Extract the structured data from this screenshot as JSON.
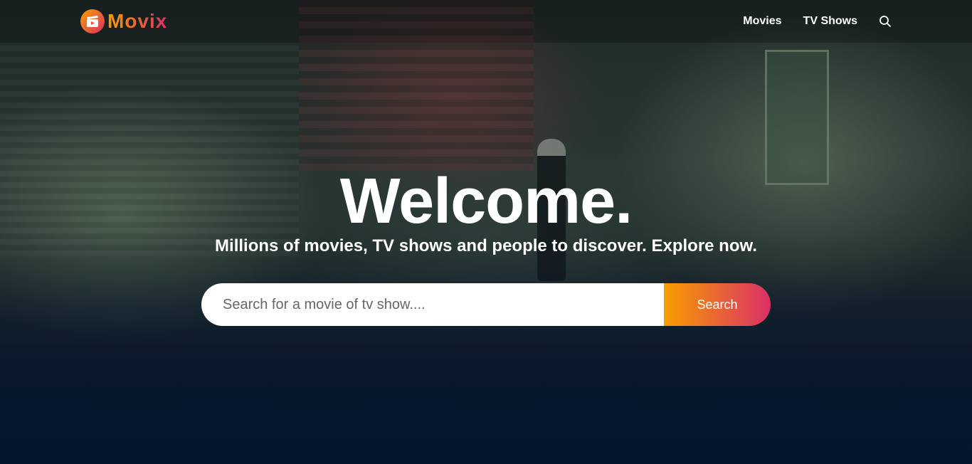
{
  "header": {
    "logo_text": "Movix",
    "nav": {
      "movies_label": "Movies",
      "tv_shows_label": "TV Shows",
      "search_icon": "search-icon"
    }
  },
  "hero": {
    "title": "Welcome.",
    "subtitle": "Millions of movies, TV shows and people to discover. Explore now.",
    "search": {
      "placeholder": "Search for a movie of tv show....",
      "value": "",
      "button_label": "Search"
    }
  },
  "colors": {
    "background": "#04152d",
    "accent_start": "#f89e00",
    "accent_end": "#da2f68"
  }
}
